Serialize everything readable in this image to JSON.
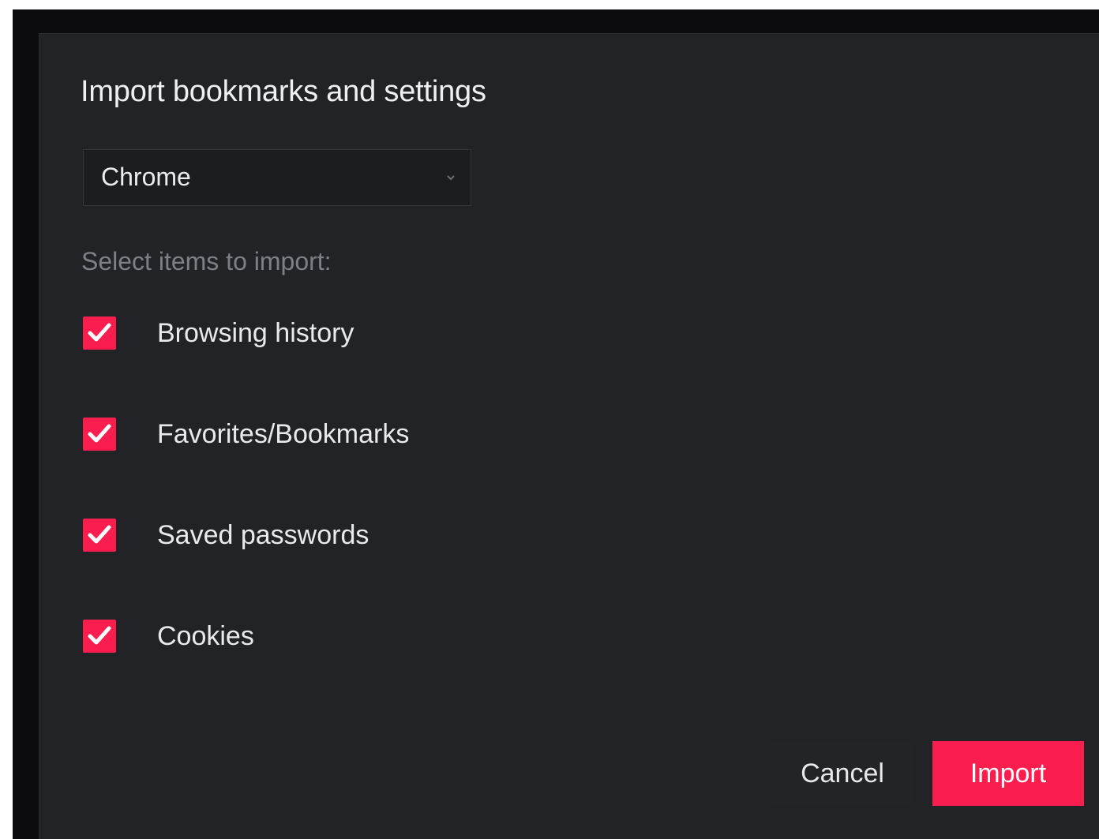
{
  "dialog": {
    "title": "Import bookmarks and settings",
    "browser_select": {
      "selected": "Chrome"
    },
    "section_label": "Select items to import:",
    "items": [
      {
        "label": "Browsing history",
        "checked": true
      },
      {
        "label": "Favorites/Bookmarks",
        "checked": true
      },
      {
        "label": "Saved passwords",
        "checked": true
      },
      {
        "label": "Cookies",
        "checked": true
      }
    ],
    "buttons": {
      "cancel": "Cancel",
      "import": "Import"
    }
  },
  "colors": {
    "accent": "#fa1e4e",
    "dialog_background": "#222327",
    "text": "#eaeaec",
    "muted_text": "#7f8086"
  },
  "icons": {
    "checkbox_mark": "check-icon",
    "select_arrow": "chevron-down-icon"
  }
}
